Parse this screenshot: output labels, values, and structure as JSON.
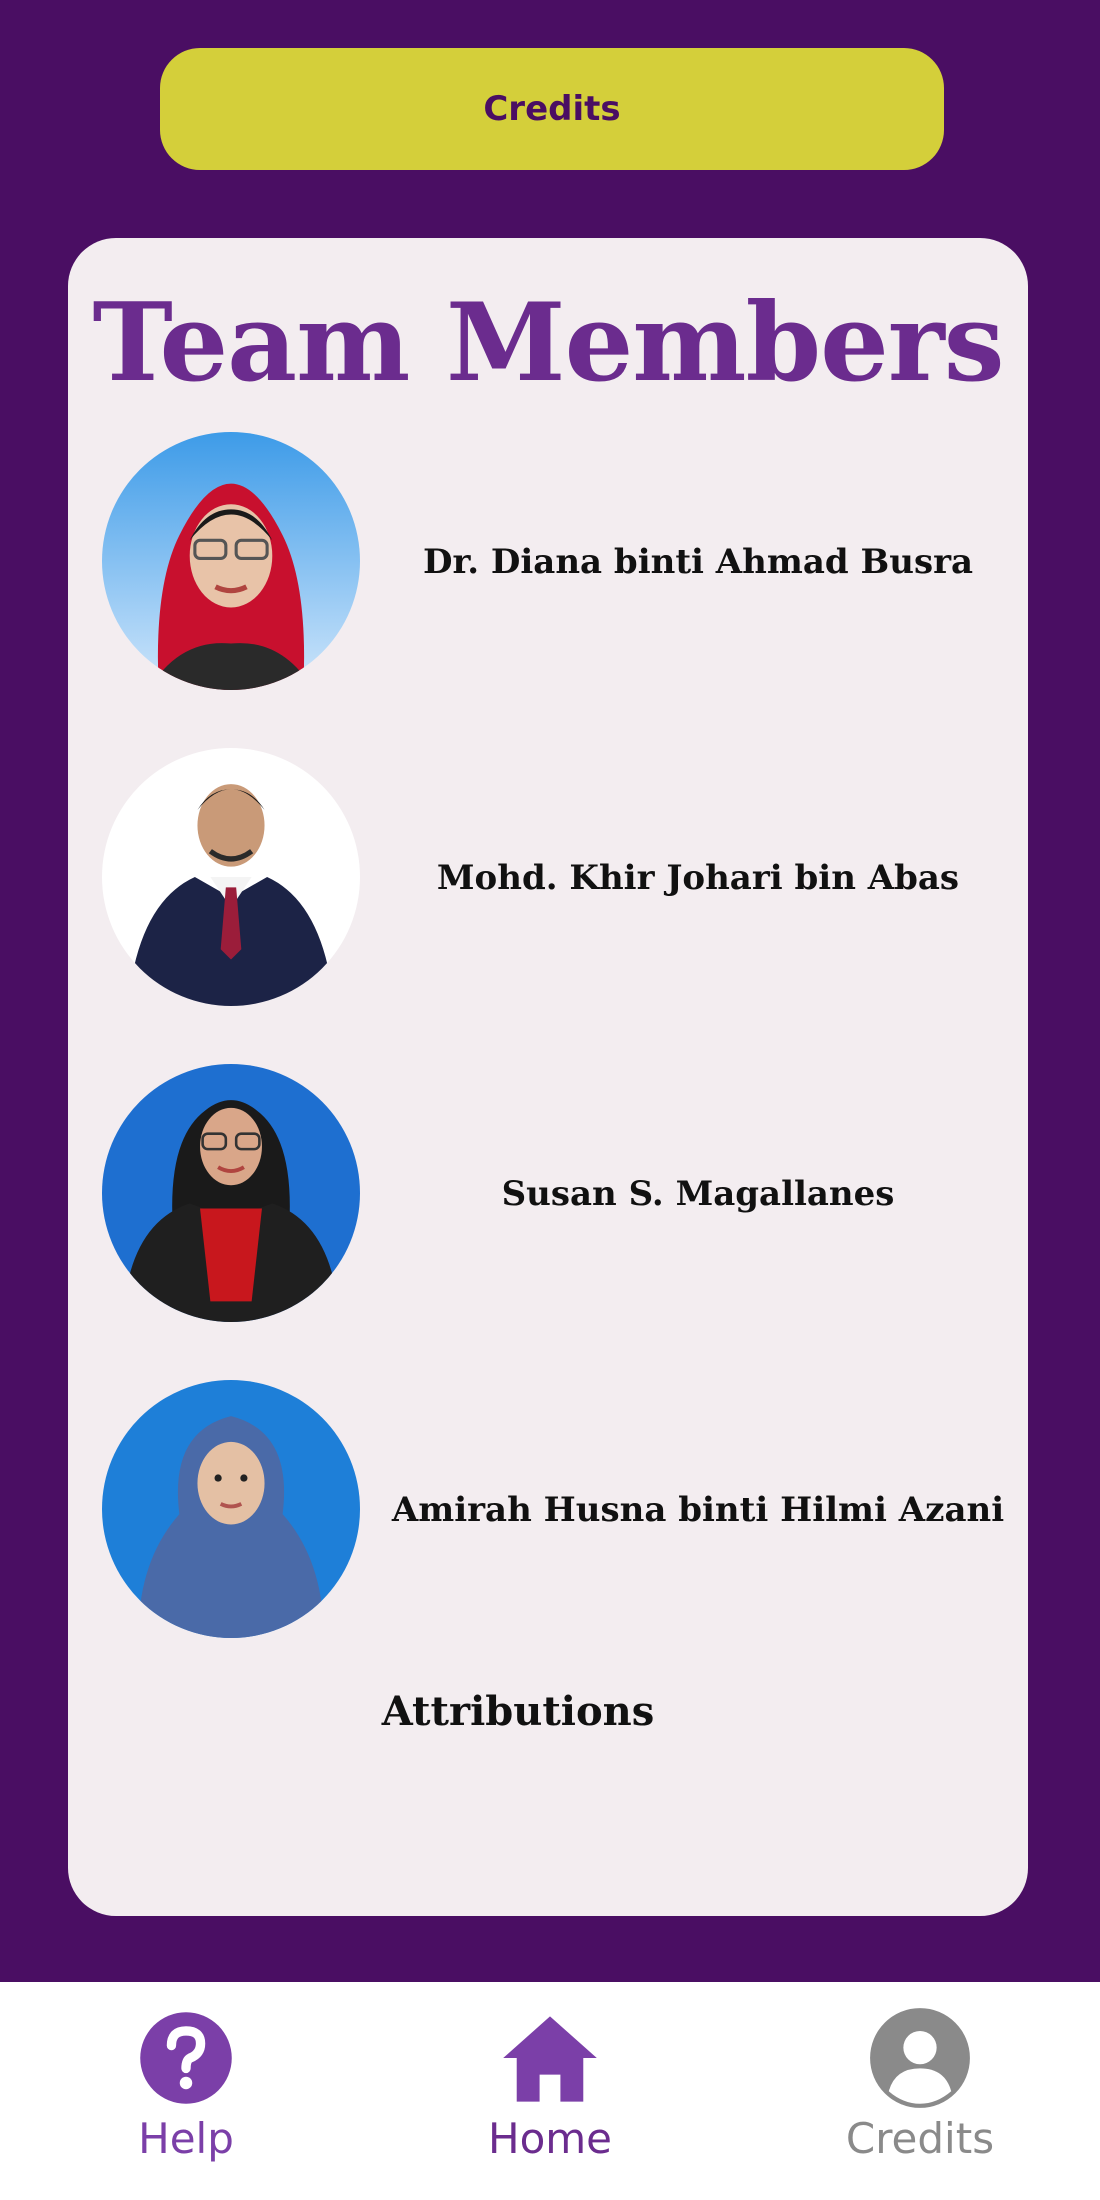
{
  "header": {
    "button_label": "Credits"
  },
  "card": {
    "title": "Team Members",
    "members": [
      {
        "name": "Dr. Diana binti Ahmad Busra",
        "avatar": "portrait-photo"
      },
      {
        "name": "Mohd. Khir Johari bin Abas",
        "avatar": "portrait-photo"
      },
      {
        "name": "Susan S. Magallanes",
        "avatar": "portrait-photo"
      },
      {
        "name": "Amirah Husna binti Hilmi Azani",
        "avatar": "portrait-photo"
      }
    ],
    "attributions_label": "Attributions"
  },
  "nav": {
    "items": [
      {
        "label": "Help",
        "icon": "help-icon",
        "color": "#7b3fa8"
      },
      {
        "label": "Home",
        "icon": "home-icon",
        "color": "#6b2c8e"
      },
      {
        "label": "Credits",
        "icon": "user-icon",
        "color": "#8a8a8a"
      }
    ]
  },
  "colors": {
    "background": "#4a0e63",
    "accent_button": "#d4cf3a",
    "card": "#f3edf0",
    "title": "#6b2c8e"
  }
}
